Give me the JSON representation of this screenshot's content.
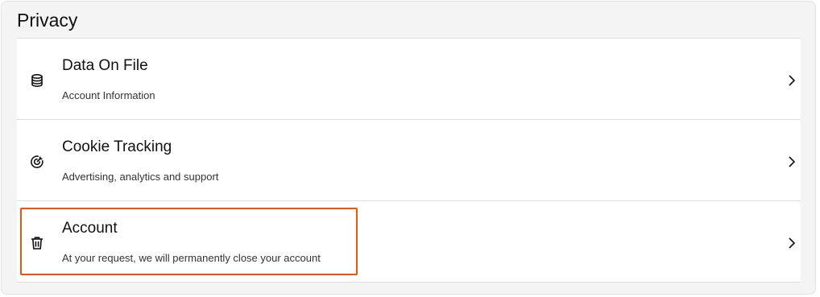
{
  "section": {
    "title": "Privacy"
  },
  "items": [
    {
      "title": "Data On File",
      "subtitle": "Account Information",
      "icon": "database-icon"
    },
    {
      "title": "Cookie Tracking",
      "subtitle": "Advertising, analytics and support",
      "icon": "target-icon"
    },
    {
      "title": "Account",
      "subtitle": "At your request, we will permanently close your account",
      "icon": "trash-icon"
    }
  ],
  "colors": {
    "highlight": "#e8560f",
    "panel_bg": "#f4f4f5",
    "divider": "#dedede"
  }
}
